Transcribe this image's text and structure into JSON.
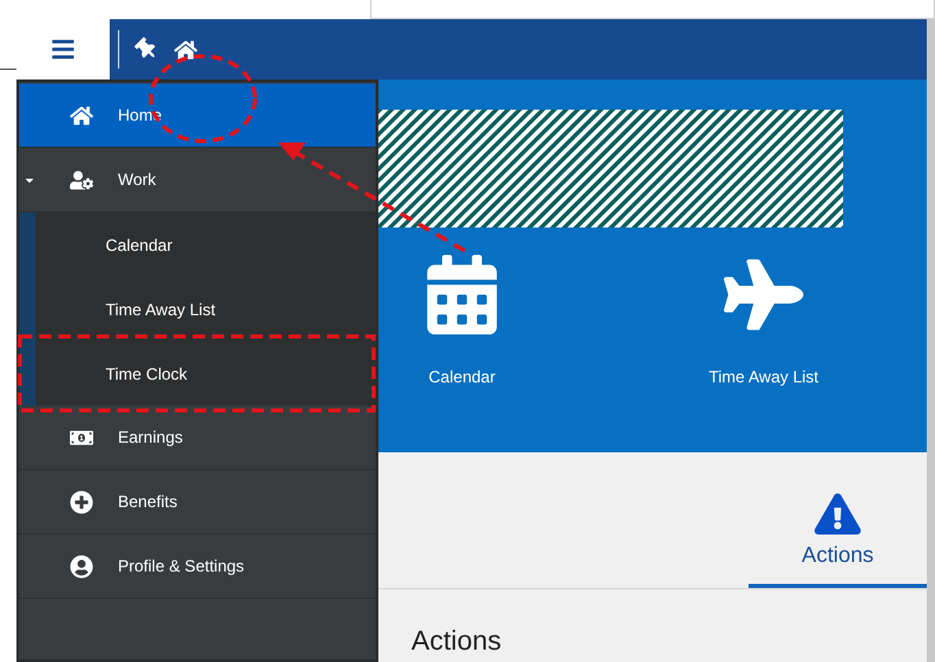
{
  "menu": {
    "items": [
      {
        "label": "Home",
        "selected": true
      },
      {
        "label": "Work",
        "selected": false,
        "expanded": true,
        "children": [
          {
            "label": "Calendar",
            "selected": false
          },
          {
            "label": "Time Away List",
            "selected": false
          },
          {
            "label": "Time Clock",
            "selected": false
          }
        ]
      },
      {
        "label": "Earnings",
        "selected": false
      },
      {
        "label": "Benefits",
        "selected": false
      },
      {
        "label": "Profile & Settings",
        "selected": false
      }
    ]
  },
  "hero": {
    "tiles": [
      {
        "label": "Calendar"
      },
      {
        "label": "Time Away List"
      }
    ]
  },
  "tabs": [
    {
      "label": "Actions",
      "selected": true
    }
  ],
  "section": {
    "heading": "Actions"
  }
}
